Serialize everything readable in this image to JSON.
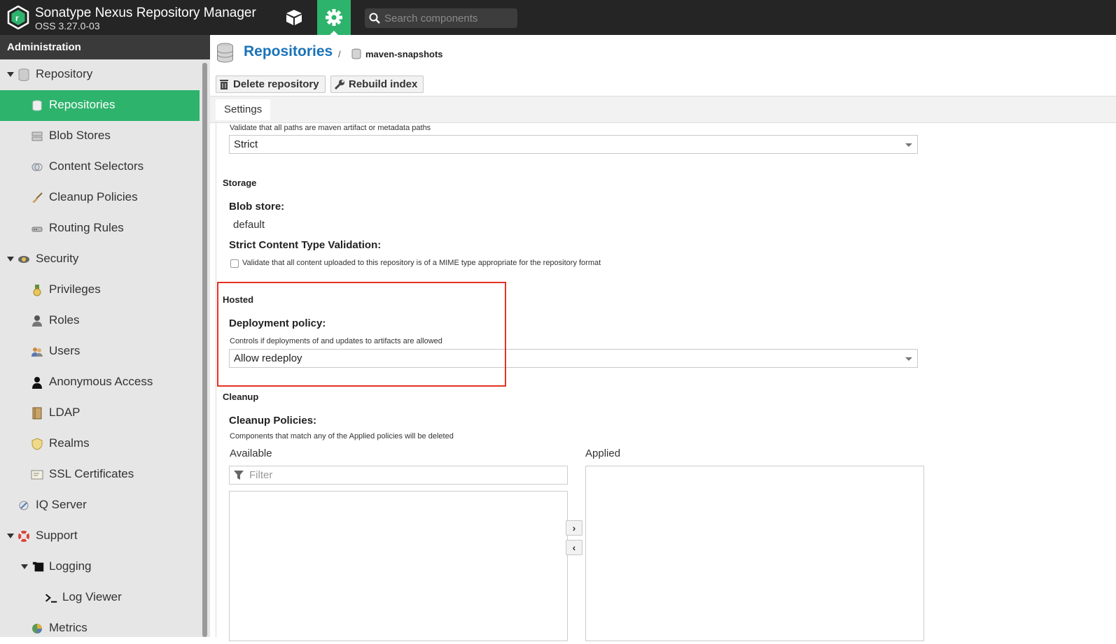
{
  "header": {
    "app_title": "Sonatype Nexus Repository Manager",
    "app_version": "OSS 3.27.0-03",
    "search_placeholder": "Search components",
    "icons": {
      "logo": "nexus-logo-icon",
      "browse": "cube-icon",
      "admin": "gear-icon",
      "search": "search-icon"
    },
    "accent_color": "#2db36c"
  },
  "sidebar": {
    "title": "Administration",
    "items": [
      {
        "label": "Repository",
        "icon": "database-icon",
        "level": 0,
        "expandable": true
      },
      {
        "label": "Repositories",
        "icon": "database-icon",
        "level": 1,
        "active": true
      },
      {
        "label": "Blob Stores",
        "icon": "server-icon",
        "level": 1
      },
      {
        "label": "Content Selectors",
        "icon": "selector-icon",
        "level": 1
      },
      {
        "label": "Cleanup Policies",
        "icon": "broom-icon",
        "level": 1
      },
      {
        "label": "Routing Rules",
        "icon": "router-icon",
        "level": 1
      },
      {
        "label": "Security",
        "icon": "eye-icon",
        "level": 0,
        "expandable": true
      },
      {
        "label": "Privileges",
        "icon": "medal-icon",
        "level": 1
      },
      {
        "label": "Roles",
        "icon": "role-icon",
        "level": 1
      },
      {
        "label": "Users",
        "icon": "users-icon",
        "level": 1
      },
      {
        "label": "Anonymous Access",
        "icon": "user-icon",
        "level": 1
      },
      {
        "label": "LDAP",
        "icon": "book-icon",
        "level": 1
      },
      {
        "label": "Realms",
        "icon": "shield-icon",
        "level": 1
      },
      {
        "label": "SSL Certificates",
        "icon": "certificate-icon",
        "level": 1
      },
      {
        "label": "IQ Server",
        "icon": "iq-icon",
        "level": 0
      },
      {
        "label": "Support",
        "icon": "lifebuoy-icon",
        "level": 0,
        "expandable": true
      },
      {
        "label": "Logging",
        "icon": "scroll-icon",
        "level": 1,
        "expandable": true
      },
      {
        "label": "Log Viewer",
        "icon": "terminal-icon",
        "level": 2
      },
      {
        "label": "Metrics",
        "icon": "pie-chart-icon",
        "level": 1
      }
    ]
  },
  "breadcrumb": {
    "title": "Repositories",
    "separator": "/",
    "current": "maven-snapshots"
  },
  "toolbar": {
    "delete_label": "Delete repository",
    "rebuild_label": "Rebuild index"
  },
  "tabs": {
    "settings": "Settings"
  },
  "form": {
    "layout_policy_help": "Validate that all paths are maven artifact or metadata paths",
    "layout_policy_value": "Strict",
    "storage_title": "Storage",
    "blob_store_label": "Blob store:",
    "blob_store_value": "default",
    "strict_content_label": "Strict Content Type Validation:",
    "strict_content_help": "Validate that all content uploaded to this repository is of a MIME type appropriate for the repository format",
    "hosted_title": "Hosted",
    "deployment_label": "Deployment policy:",
    "deployment_help": "Controls if deployments of and updates to artifacts are allowed",
    "deployment_value": "Allow redeploy",
    "cleanup_title": "Cleanup",
    "cleanup_label": "Cleanup Policies:",
    "cleanup_help": "Components that match any of the Applied policies will be deleted",
    "available_label": "Available",
    "applied_label": "Applied",
    "filter_placeholder": "Filter",
    "move_right": "›",
    "move_left": "‹"
  },
  "highlight_color": "#e53224"
}
